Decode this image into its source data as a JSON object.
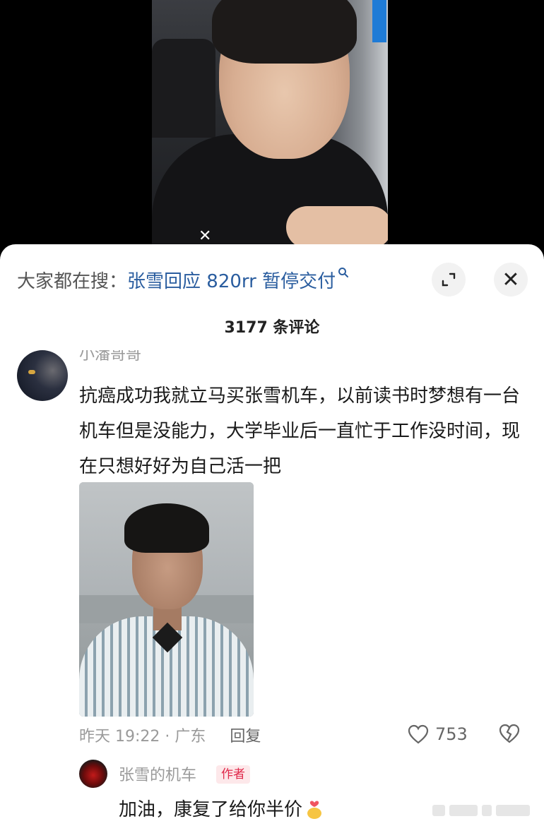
{
  "search": {
    "prefix": "大家都在搜：",
    "term": "张雪回应 820rr 暂停交付",
    "icon": "search-icon"
  },
  "controls": {
    "expand_icon": "expand-icon",
    "close_glyph": "✕"
  },
  "comments_header": {
    "count_text": "3177 条评论"
  },
  "comment": {
    "username": "小潘哥哥",
    "text": "抗癌成功我就立马买张雪机车，以前读书时梦想有一台机车但是没能力，大学毕业后一直忙于工作没时间，现在只想好好为自己活一把",
    "time_location": "昨天 19:22 · 广东",
    "reply_label": "回复",
    "like_count": "753"
  },
  "reply": {
    "username": "张雪的机车",
    "badge": "作者",
    "text": "加油，康复了给你半价"
  },
  "colors": {
    "link_blue": "#2a5d9f",
    "badge_red": "#e0284a",
    "badge_bg": "#fde8ea",
    "muted_gray": "#9a9a9a"
  }
}
